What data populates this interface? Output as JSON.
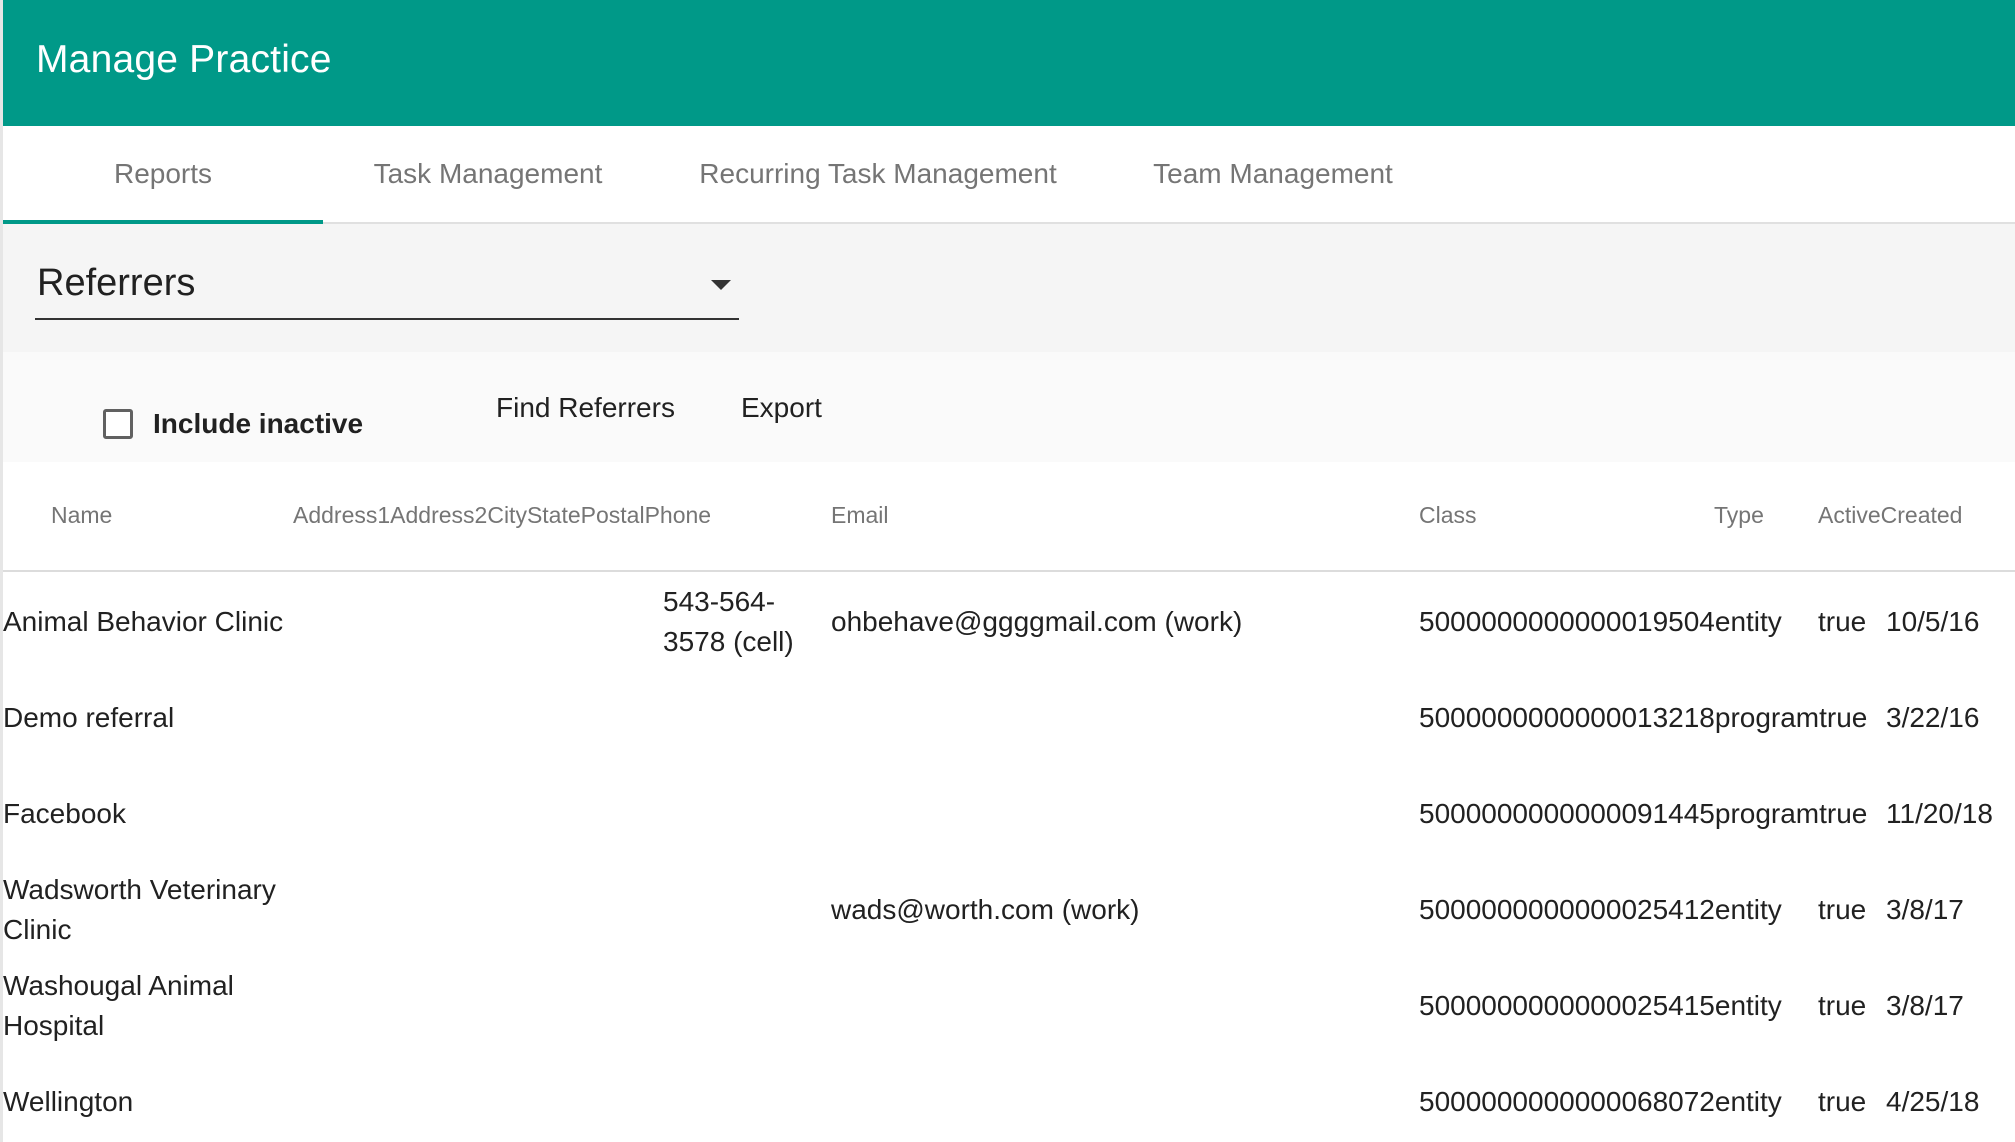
{
  "app": {
    "title": "Manage Practice"
  },
  "tabs": [
    {
      "label": "Reports"
    },
    {
      "label": "Task Management"
    },
    {
      "label": "Recurring Task Management"
    },
    {
      "label": "Team Management"
    }
  ],
  "report_select": {
    "selected": "Referrers"
  },
  "toolbar": {
    "include_inactive_label": "Include inactive",
    "include_inactive_checked": false,
    "find_label": "Find Referrers",
    "export_label": "Export"
  },
  "table": {
    "headers": {
      "name": "Name",
      "address_group": "Address1Address2CityStatePostalPhone",
      "email": "Email",
      "class": "Class",
      "type": "Type",
      "active_created": "ActiveCreated"
    },
    "rows": [
      {
        "name_line1": "Animal Behavior Clinic",
        "name_line2": "",
        "phone_line1": "543-564-",
        "phone_line2": "3578 (cell)",
        "email": "ohbehave@ggggmail.com (work)",
        "class_type": "5000000000000019504entity",
        "active": "true",
        "created": "10/5/16"
      },
      {
        "name_line1": "Demo referral",
        "name_line2": "",
        "phone_line1": "",
        "phone_line2": "",
        "email": "",
        "class_type": "5000000000000013218programtrue",
        "active": "",
        "created": "3/22/16"
      },
      {
        "name_line1": "Facebook",
        "name_line2": "",
        "phone_line1": "",
        "phone_line2": "",
        "email": "",
        "class_type": "5000000000000091445programtrue",
        "active": "",
        "created": "11/20/18"
      },
      {
        "name_line1": "Wadsworth Veterinary",
        "name_line2": "Clinic",
        "phone_line1": "",
        "phone_line2": "",
        "email": "wads@worth.com (work)",
        "class_type": "5000000000000025412entity",
        "active": "true",
        "created": "3/8/17"
      },
      {
        "name_line1": "Washougal Animal",
        "name_line2": "Hospital",
        "phone_line1": "",
        "phone_line2": "",
        "email": "",
        "class_type": "5000000000000025415entity",
        "active": "true",
        "created": "3/8/17"
      },
      {
        "name_line1": "Wellington",
        "name_line2": "",
        "phone_line1": "",
        "phone_line2": "",
        "email": "",
        "class_type": "5000000000000068072entity",
        "active": "true",
        "created": "4/25/18"
      }
    ]
  },
  "colors": {
    "primary": "#009988",
    "header_text": "#ffffff",
    "muted_text": "#757575"
  }
}
